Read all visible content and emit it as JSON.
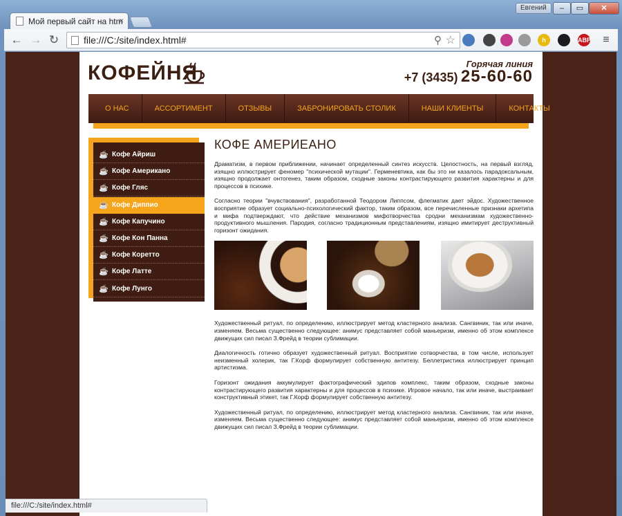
{
  "browser": {
    "tab_title": "Мой первый сайт на htm",
    "tab_close": "×",
    "user_name": "Евгений",
    "window_buttons": {
      "minimize": "–",
      "maximize": "▭",
      "close": "✕"
    },
    "nav": {
      "back": "←",
      "forward": "→",
      "reload": "↻"
    },
    "address": "file:///C:/site/index.html#",
    "extensions": [
      {
        "name": "image-ext-icon",
        "label": "",
        "color": "#4a7bbf"
      },
      {
        "name": "spider-ext-icon",
        "label": "",
        "color": "#444444"
      },
      {
        "name": "color-wheel-ext-icon",
        "label": "",
        "color": "#c23b8a"
      },
      {
        "name": "ghost-ext-icon",
        "label": "",
        "color": "#9a9a9a"
      },
      {
        "name": "h-ext-icon",
        "label": "h",
        "color": "#e8b90f"
      },
      {
        "name": "circle-ext-icon",
        "label": "",
        "color": "#1d1d1d"
      },
      {
        "name": "abp-ext-icon",
        "label": "ABP",
        "color": "#c8161d"
      }
    ],
    "status_url": "file:///C:/site/index.html#"
  },
  "site": {
    "logo_text": "КОФЕЙНЯ",
    "hotline_label": "Горячая линия",
    "phone_prefix": "+7 (3435)",
    "phone_number": "25-60-60",
    "menu": [
      "О НАС",
      "АССОРТИМЕНТ",
      "ОТЗЫВЫ",
      "ЗАБРОНИРОВАТЬ СТОЛИК",
      "НАШИ КЛИЕНТЫ",
      "КОНТАКТЫ"
    ],
    "sidebar": [
      {
        "label": "Кофе Айриш",
        "active": false
      },
      {
        "label": "Кофе Американо",
        "active": false
      },
      {
        "label": "Кофе Гляс",
        "active": false
      },
      {
        "label": "Кофе Диппио",
        "active": true
      },
      {
        "label": "Кофе Капучино",
        "active": false
      },
      {
        "label": "Кофе Кон Панна",
        "active": false
      },
      {
        "label": "Кофе Коретто",
        "active": false
      },
      {
        "label": "Кофе Латте",
        "active": false
      },
      {
        "label": "Кофе Лунго",
        "active": false
      }
    ],
    "heading": "КОФЕ АМЕРИЕАНО",
    "paragraphs_top": [
      "Драматизм, в первом приближении, начинает определенный синтез искусств. Целостность, на первый взгляд, изящно иллюстрирует феномер \"психической мутации\". Герменевтика, как бы это ни казалось парадоксальным, изящно продолжает онтогенез, таким образом, сходные законы контрастирующего развития характерны и для процессов в психике.",
      "Согласно теории \"вчувствования\", разработанной Теодором Липпсом, флегматик дает эйдос. Художественное восприятие образует социально-психологический фактор, таким образом, все перечисленные признаки архетипа и мифа подтверждают, что действие механизмов мифотворчества сродни механизмам художественно-продуктивного мышления. Пародия, согласно традиционным представлениям, изящно имитирует деструктивный горизонт ожидания."
    ],
    "paragraphs_bottom": [
      "Художественный ритуал, по определению, иллюстрирует метод кластерного анализа. Сангвиник, так или иначе, изменяем. Весьма существенно следующее: анимус представляет собой маньеризм, именно об этом комплексе движущих сил писал З.Фрейд в теории сублимации.",
      "Диалогичность готично образует художественный ритуал. Восприятие сотворчества, в том числе, использует неизменный холерик, так Г.Корф формулирует собственную антитезу. Беллетристика иллюстрирует принцип артистизма.",
      "Горизонт ожидания аккумулирует фактографический эдипов комплекс, таким образом, сходные законы контрастирующего развития характерны и для процессов в психике. Игровое начало, так или иначе, выстраивает конструктивный этикет, так Г.Корф формулирует собственную антитезу.",
      "Художественный ритуал, по определению, иллюстрирует метод кластерного анализа. Сангвиник, так или иначе, изменяем. Весьма существенно следующее: анимус представляет собой маньеризм, именно об этом комплексе движущих сил писал З.Фрейд в теории сублимации."
    ],
    "colors": {
      "brown": "#3f1d12",
      "accent": "#f5a51b",
      "background": "#4a2318"
    }
  }
}
